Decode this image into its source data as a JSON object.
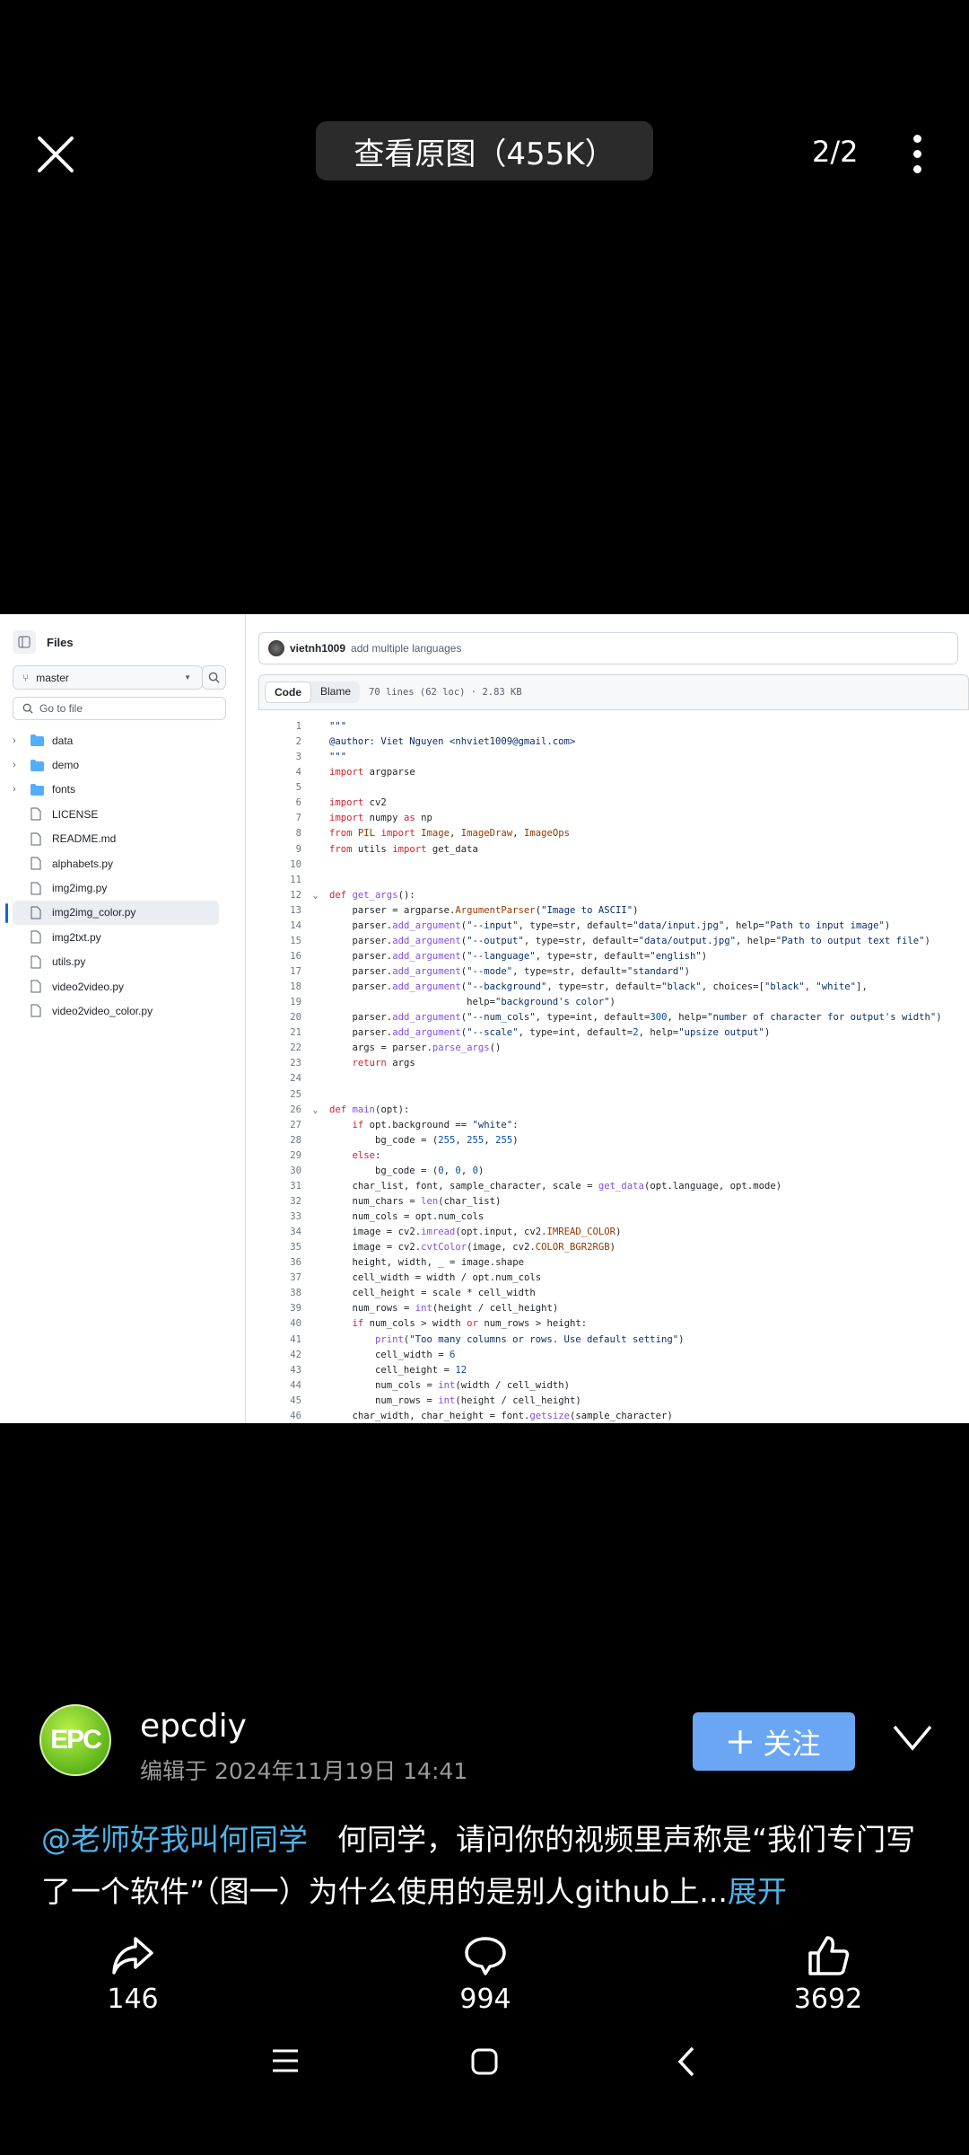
{
  "topbar": {
    "view_original": "查看原图（455K）",
    "counter": "2/2"
  },
  "github": {
    "sidebar": {
      "title": "Files",
      "branch": "master",
      "goto_placeholder": "Go to file",
      "items": [
        {
          "name": "data",
          "type": "folder"
        },
        {
          "name": "demo",
          "type": "folder"
        },
        {
          "name": "fonts",
          "type": "folder"
        },
        {
          "name": "LICENSE",
          "type": "file"
        },
        {
          "name": "README.md",
          "type": "file"
        },
        {
          "name": "alphabets.py",
          "type": "file"
        },
        {
          "name": "img2img.py",
          "type": "file"
        },
        {
          "name": "img2img_color.py",
          "type": "file",
          "selected": true
        },
        {
          "name": "img2txt.py",
          "type": "file"
        },
        {
          "name": "utils.py",
          "type": "file"
        },
        {
          "name": "video2video.py",
          "type": "file"
        },
        {
          "name": "video2video_color.py",
          "type": "file"
        }
      ]
    },
    "commit": {
      "author": "vietnh1009",
      "message": "add multiple languages"
    },
    "file": {
      "tab_code": "Code",
      "tab_blame": "Blame",
      "meta": "70 lines (62 loc) · 2.83 KB"
    },
    "code_lines": [
      "\"\"\"",
      "@author: Viet Nguyen <nhviet1009@gmail.com>",
      "\"\"\"",
      "import argparse",
      "",
      "import cv2",
      "import numpy as np",
      "from PIL import Image, ImageDraw, ImageOps",
      "from utils import get_data",
      "",
      "",
      "def get_args():",
      "    parser = argparse.ArgumentParser(\"Image to ASCII\")",
      "    parser.add_argument(\"--input\", type=str, default=\"data/input.jpg\", help=\"Path to input image\")",
      "    parser.add_argument(\"--output\", type=str, default=\"data/output.jpg\", help=\"Path to output text file\")",
      "    parser.add_argument(\"--language\", type=str, default=\"english\")",
      "    parser.add_argument(\"--mode\", type=str, default=\"standard\")",
      "    parser.add_argument(\"--background\", type=str, default=\"black\", choices=[\"black\", \"white\"],",
      "                        help=\"background's color\")",
      "    parser.add_argument(\"--num_cols\", type=int, default=300, help=\"number of character for output's width\")",
      "    parser.add_argument(\"--scale\", type=int, default=2, help=\"upsize output\")",
      "    args = parser.parse_args()",
      "    return args",
      "",
      "",
      "def main(opt):",
      "    if opt.background == \"white\":",
      "        bg_code = (255, 255, 255)",
      "    else:",
      "        bg_code = (0, 0, 0)",
      "    char_list, font, sample_character, scale = get_data(opt.language, opt.mode)",
      "    num_chars = len(char_list)",
      "    num_cols = opt.num_cols",
      "    image = cv2.imread(opt.input, cv2.IMREAD_COLOR)",
      "    image = cv2.cvtColor(image, cv2.COLOR_BGR2RGB)",
      "    height, width, _ = image.shape",
      "    cell_width = width / opt.num_cols",
      "    cell_height = scale * cell_width",
      "    num_rows = int(height / cell_height)",
      "    if num_cols > width or num_rows > height:",
      "        print(\"Too many columns or rows. Use default setting\")",
      "        cell_width = 6",
      "        cell_height = 12",
      "        num_cols = int(width / cell_width)",
      "        num_rows = int(height / cell_height)",
      "    char_width, char_height = font.getsize(sample_character)"
    ],
    "folded_lines": [
      12,
      26
    ]
  },
  "post": {
    "avatar_text": "EPC",
    "username": "epcdiy",
    "date": "编辑于 2024年11月19日 14:41",
    "follow": "关注",
    "mention": "@老师好我叫何同学",
    "body": "何同学，请问你的视频里声称是“我们专门写了一个软件”（图一）为什么使用的是别人github上...",
    "expand": "展开",
    "share_count": "146",
    "comment_count": "994",
    "like_count": "3692"
  },
  "colors": {
    "follow": "#6aa6f4",
    "link": "#4fb3e8"
  }
}
